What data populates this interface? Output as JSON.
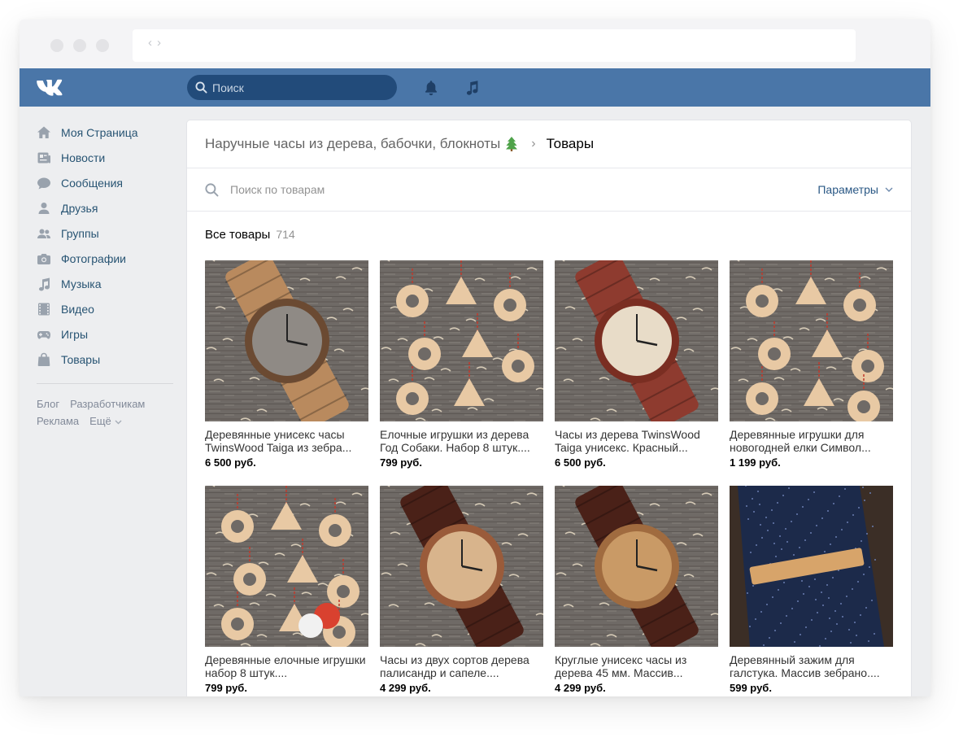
{
  "header": {
    "search_placeholder": "Поиск"
  },
  "sidebar": {
    "items": [
      {
        "label": "Моя Страница",
        "icon": "home-icon"
      },
      {
        "label": "Новости",
        "icon": "news-icon"
      },
      {
        "label": "Сообщения",
        "icon": "messages-icon"
      },
      {
        "label": "Друзья",
        "icon": "friends-icon"
      },
      {
        "label": "Группы",
        "icon": "groups-icon"
      },
      {
        "label": "Фотографии",
        "icon": "camera-icon"
      },
      {
        "label": "Музыка",
        "icon": "music-icon"
      },
      {
        "label": "Видео",
        "icon": "video-icon"
      },
      {
        "label": "Игры",
        "icon": "gamepad-icon"
      },
      {
        "label": "Товары",
        "icon": "shopping-bag-icon"
      }
    ],
    "footer_links": [
      "Блог",
      "Разработчикам",
      "Реклама",
      "Ещё"
    ]
  },
  "breadcrumb": {
    "store": "Наручные часы из дерева, бабочки, блокноты",
    "current": "Товары"
  },
  "search": {
    "placeholder": "Поиск по товарам",
    "params_label": "Параметры"
  },
  "catalog": {
    "title": "Все товары",
    "count": "714"
  },
  "products": [
    {
      "title": "Деревянные унисекс часы TwinsWood Taiga из зебра...",
      "price": "6 500 руб.",
      "image": "watch-zebrano"
    },
    {
      "title": "Елочные игрушки из дерева Год Собаки. Набор 8 штук....",
      "price": "799 руб.",
      "image": "ornaments-dog"
    },
    {
      "title": "Часы из дерева TwinsWood Taiga унисекс. Красный...",
      "price": "6 500 руб.",
      "image": "watch-red"
    },
    {
      "title": "Деревянные игрушки для новогодней елки Символ...",
      "price": "1 199 руб.",
      "image": "ornaments-symbol"
    },
    {
      "title": "Деревянные елочные игрушки набор 8 штук....",
      "price": "799 руб.",
      "image": "ornaments-set"
    },
    {
      "title": "Часы из двух сортов дерева палисандр и сапеле....",
      "price": "4 299 руб.",
      "image": "watch-leather"
    },
    {
      "title": "Круглые унисекс часы из дерева 45 мм. Массив...",
      "price": "4 299 руб.",
      "image": "watch-round"
    },
    {
      "title": "Деревянный зажим для галстука. Массив зебрано....",
      "price": "599 руб.",
      "image": "tie-clip"
    }
  ],
  "colors": {
    "header": "#4a76a8",
    "link": "#2a5885",
    "sidebar_text": "#285473",
    "icon": "#99a2ad"
  }
}
